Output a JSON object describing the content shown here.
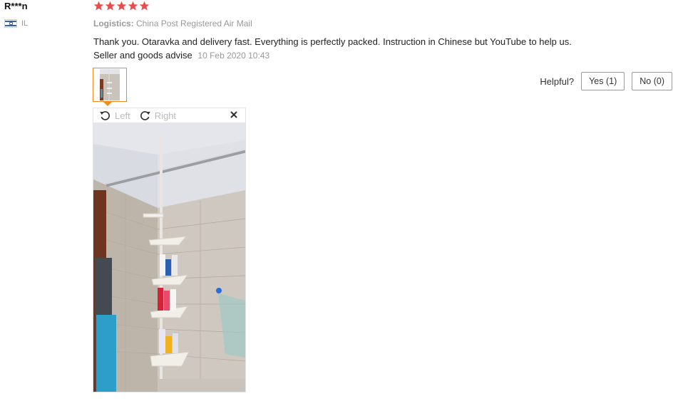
{
  "reviewer": {
    "name": "R***n",
    "country_code": "IL",
    "flag_icon": "israel-flag-icon"
  },
  "rating": {
    "stars": 5,
    "max": 5,
    "color": "#f04a4a"
  },
  "logistics": {
    "label": "Logistics:",
    "value": "China Post Registered Air Mail"
  },
  "review": {
    "line1": "Thank you. Otaravka and delivery fast. Everything is perfectly packed. Instruction in Chinese but YouTube to help us.",
    "line2": "Seller and goods advise",
    "date": "10 Feb 2020 10:43"
  },
  "helpful": {
    "label": "Helpful?",
    "yes_label": "Yes (1)",
    "no_label": "No (0)"
  },
  "viewer": {
    "rotate_left_label": "Left",
    "rotate_right_label": "Right",
    "rotate_left_icon": "rotate-left-icon",
    "rotate_right_icon": "rotate-right-icon",
    "close_icon": "close-icon",
    "accent_color": "#f28a1a"
  }
}
